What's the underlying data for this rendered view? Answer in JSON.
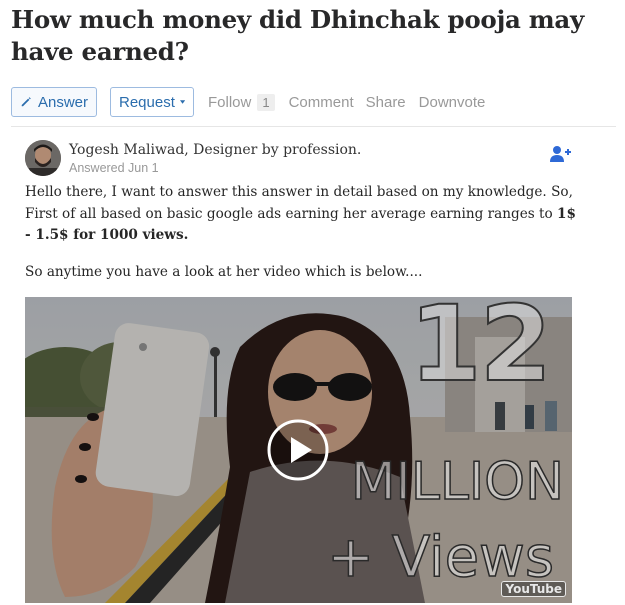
{
  "question": {
    "title": "How much money did Dhinchak pooja may have earned?"
  },
  "actions": {
    "answer_label": "Answer",
    "request_label": "Request",
    "follow_label": "Follow",
    "follow_count": "1",
    "comment_label": "Comment",
    "share_label": "Share",
    "downvote_label": "Downvote"
  },
  "answer": {
    "author_name": "Yogesh Maliwad",
    "author_credential": ", Designer by profession.",
    "answered_date": "Answered Jun 1",
    "para1_text": "Hello there, I want to answer this answer in detail based on my knowledge. So, First of all based on basic google ads earning her average earning ranges to ",
    "para1_bold": "1$ - 1.5$ for 1000 views.",
    "para2_text": "So anytime you have a look at her video which is below...."
  },
  "video": {
    "overlay_number": "12",
    "overlay_million": "MILLION",
    "overlay_views": "+ Views",
    "youtube_logo": "YouTube"
  },
  "icons": {
    "pencil": "pencil-icon",
    "caret": "chevron-down-icon",
    "add_user": "add-user-icon",
    "play": "play-icon"
  },
  "colors": {
    "link_blue": "#2b6dad",
    "muted": "#999999",
    "add_user_icon": "#2e69d6"
  }
}
